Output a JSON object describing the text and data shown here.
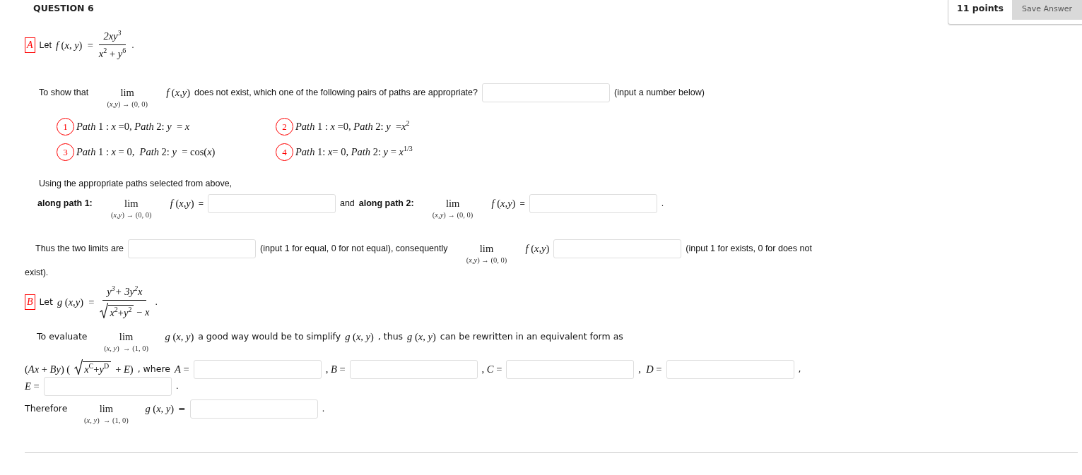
{
  "header": {
    "title": "QUESTION 6",
    "points": "11 points",
    "save_button": "Save Answer"
  },
  "parts": [
    {
      "lines": [
        {
          "items": [
            {
              "kind": "badge",
              "text": "A"
            },
            {
              "kind": "text",
              "text": "Let"
            },
            {
              "kind": "math",
              "text": "*f* (*x*, *y*)  ="
            },
            {
              "kind": "frac",
              "numerator": "2xy$^{3}$",
              "denominator": "*x*$^{2}$ + *y*$^{6}$"
            },
            {
              "kind": "text",
              "text": "."
            }
          ]
        },
        {
          "items": [
            {
              "kind": "text",
              "text": "To show that"
            },
            {
              "kind": "lim",
              "top": "lim",
              "bottom": "(*x*,*y*) → (0, 0)"
            },
            {
              "kind": "math",
              "text": "*f* (*x*,*y*)"
            },
            {
              "kind": "text",
              "text": "does  not exist, which one of the following pairs of paths are appropriate?"
            },
            {
              "kind": "field"
            },
            {
              "kind": "text",
              "text": "(input a number below)"
            }
          ]
        },
        {
          "items": [
            {
              "kind": "options",
              "options": [
                {
                  "number": "1",
                  "text": "*Path* 1 : *x* =0, *Path* 2: *y*  = *x*"
                },
                {
                  "number": "2",
                  "text": "*Path* 1 : *x* =0, *Path* 2: *y*  =*x*$^{2}$"
                },
                {
                  "number": "3",
                  "text": "*Path* 1 : *x* = 0,  *Path* 2: *y*  = cos(*x*)"
                },
                {
                  "number": "4",
                  "text": "*Path* 1: *x*= 0, *Path* 2: *y* = *x*$^{1/3}$"
                }
              ]
            }
          ]
        },
        {
          "items": [
            {
              "kind": "text",
              "text": "Using the appropriate paths selected from above,"
            }
          ]
        },
        {
          "items": [
            {
              "kind": "text",
              "text": "along path 1:",
              "bold": true
            },
            {
              "kind": "lim",
              "top": "lim",
              "bottom": "(*x*,*y*) → (0, 0)"
            },
            {
              "kind": "math",
              "text": "*f* (*x*,*y*)"
            },
            {
              "kind": "text",
              "text": "="
            },
            {
              "kind": "field"
            },
            {
              "kind": "text",
              "text": "and"
            },
            {
              "kind": "text",
              "text": "along path 2:",
              "bold": true
            },
            {
              "kind": "lim",
              "top": "lim",
              "bottom": "(*x*,*y*) → (0, 0)"
            },
            {
              "kind": "math",
              "text": "*f* (*x*,*y*)"
            },
            {
              "kind": "text",
              "text": "="
            },
            {
              "kind": "field"
            },
            {
              "kind": "text",
              "text": "."
            }
          ]
        },
        {
          "items": [
            {
              "kind": "text",
              "text": "Thus the two limits are"
            },
            {
              "kind": "field"
            },
            {
              "kind": "text",
              "text": "(input 1 for equal, 0 for not equal),  consequently"
            },
            {
              "kind": "lim",
              "top": "lim",
              "bottom": "(*x*,*y*) → (0, 0)"
            },
            {
              "kind": "math",
              "text": "*f* (*x*,*y*)"
            },
            {
              "kind": "field"
            },
            {
              "kind": "text",
              "text": "(input 1 for exists, 0 for does not"
            }
          ]
        },
        {
          "items": [
            {
              "kind": "text",
              "text": "exist)."
            }
          ]
        }
      ]
    },
    {
      "lines": [
        {
          "items": [
            {
              "kind": "badge",
              "text": "B"
            },
            {
              "kind": "text",
              "text": "Let"
            },
            {
              "kind": "math",
              "text": "*g* (*x*,*y*)  ="
            },
            {
              "kind": "frac",
              "numerator": "y$^{3}$+ 3y$^{2}$x",
              "radicand": "*x*$^{2}$+*y*$^{2}$",
              "denominator": "− *x*"
            },
            {
              "kind": "text",
              "text": "."
            }
          ]
        },
        {
          "items": [
            {
              "kind": "text",
              "text": "To evaluate"
            },
            {
              "kind": "lim",
              "top": "lim",
              "bottom": "(*x*, *y*)  → (1, 0)"
            },
            {
              "kind": "math",
              "text": "*g* (*x*, *y*)"
            },
            {
              "kind": "text",
              "text": "a good way would be  to simplify"
            },
            {
              "kind": "math",
              "text": "*g* (*x*, *y*)"
            },
            {
              "kind": "text",
              "text": ", thus"
            },
            {
              "kind": "math",
              "text": "*g* (*x*, *y*)"
            },
            {
              "kind": "text",
              "text": "can be rewritten in an equivalent form as"
            }
          ]
        },
        {
          "items": [
            {
              "kind": "math",
              "text": "(*Ax* + *By*) ("
            },
            {
              "kind": "root",
              "radicand": "*x*$^{C}$+*y*$^{D}$"
            },
            {
              "kind": "math",
              "text": "+ *E*)"
            },
            {
              "kind": "text",
              "text": ", where"
            },
            {
              "kind": "math",
              "text": "*A* ="
            },
            {
              "kind": "field"
            },
            {
              "kind": "math",
              "text": ", *B* ="
            },
            {
              "kind": "field"
            },
            {
              "kind": "math",
              "text": ", *C* ="
            },
            {
              "kind": "field"
            },
            {
              "kind": "math",
              "text": ",  *D* ="
            },
            {
              "kind": "field"
            },
            {
              "kind": "text",
              "text": ","
            }
          ]
        },
        {
          "items": [
            {
              "kind": "math",
              "text": "*E* ="
            },
            {
              "kind": "field"
            },
            {
              "kind": "text",
              "text": "."
            }
          ]
        },
        {
          "items": [
            {
              "kind": "text",
              "text": "Therefore"
            },
            {
              "kind": "lim",
              "top": "lim",
              "bottom": "(*x*, *y*)  → (1, 0)"
            },
            {
              "kind": "math",
              "text": "*g* (*x*, *y*)"
            },
            {
              "kind": "text",
              "text": "="
            },
            {
              "kind": "field"
            },
            {
              "kind": "text",
              "text": "."
            }
          ]
        }
      ]
    }
  ]
}
